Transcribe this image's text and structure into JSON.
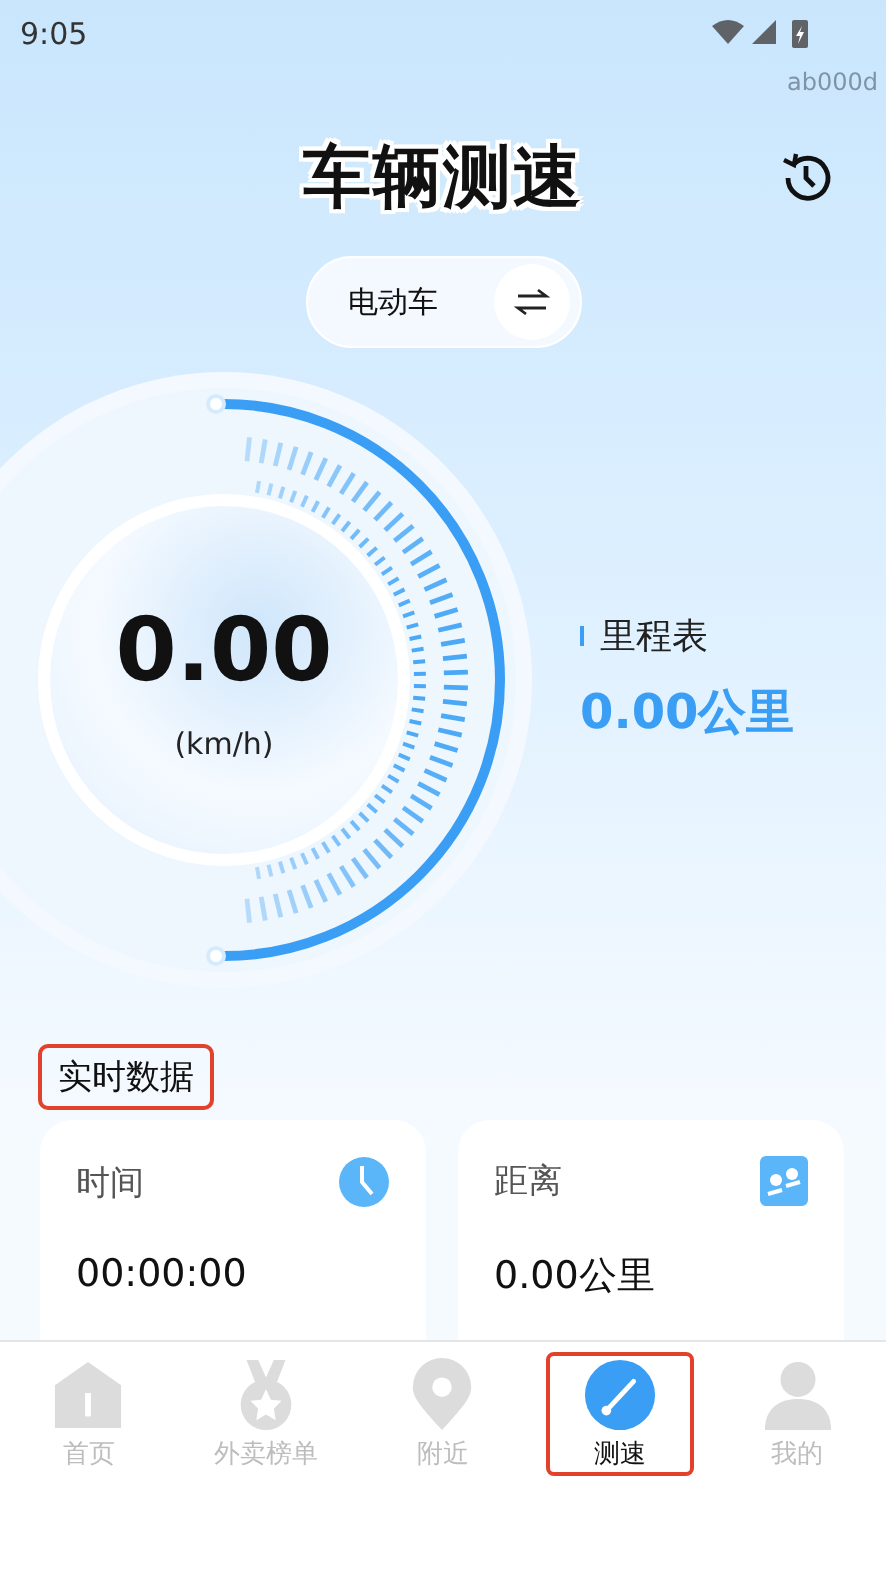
{
  "status_bar": {
    "time": "9:05",
    "device_tag": "ab000d"
  },
  "header": {
    "title": "车辆测速"
  },
  "vehicle_switch": {
    "label": "电动车"
  },
  "gauge": {
    "speed": "0.00",
    "unit": "(km/h)"
  },
  "odometer": {
    "label": "里程表",
    "value": "0.00公里"
  },
  "realtime": {
    "title": "实时数据",
    "highlighted": true,
    "cards": [
      {
        "kind": "time",
        "label": "时间",
        "value": "00:00:00"
      },
      {
        "kind": "distance",
        "label": "距离",
        "value": "0.00公里"
      }
    ]
  },
  "bottom_nav": [
    {
      "kind": "home",
      "label": "首页",
      "selected": false,
      "highlighted": false
    },
    {
      "kind": "medal",
      "label": "外卖榜单",
      "selected": false,
      "highlighted": false
    },
    {
      "kind": "pin",
      "label": "附近",
      "selected": false,
      "highlighted": false
    },
    {
      "kind": "speed",
      "label": "测速",
      "selected": true,
      "highlighted": true
    },
    {
      "kind": "person",
      "label": "我的",
      "selected": false,
      "highlighted": false
    }
  ]
}
